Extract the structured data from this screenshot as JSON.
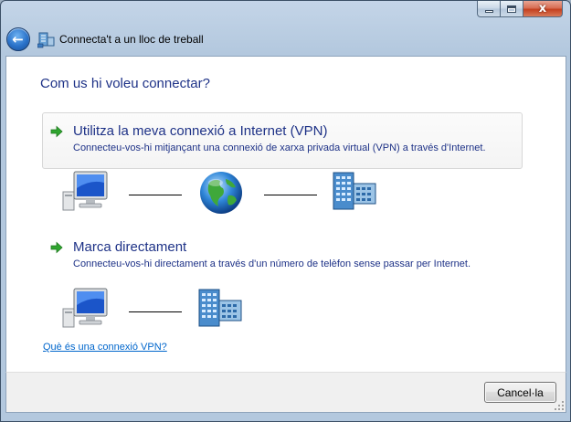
{
  "window": {
    "title": "Connecta't a un lloc de treball",
    "caption_close": "x"
  },
  "heading": "Com us hi voleu connectar?",
  "options": [
    {
      "title": "Utilitza la meva connexió a Internet (VPN)",
      "description": "Connecteu-vos-hi mitjançant una connexió de xarxa privada virtual (VPN) a través d'Internet.",
      "diagram": [
        "computer-icon",
        "globe-icon",
        "workplace-building-icon"
      ]
    },
    {
      "title": "Marca directament",
      "description": "Connecteu-vos-hi directament a través d'un número de telèfon sense passar per Internet.",
      "diagram": [
        "computer-icon",
        "workplace-building-icon"
      ]
    }
  ],
  "help_link": "Què és una connexió VPN?",
  "footer": {
    "cancel_label": "Cancel·la"
  },
  "colors": {
    "heading_text": "#1e3287",
    "link": "#0066cc",
    "arrow_green": "#2fa52f"
  }
}
